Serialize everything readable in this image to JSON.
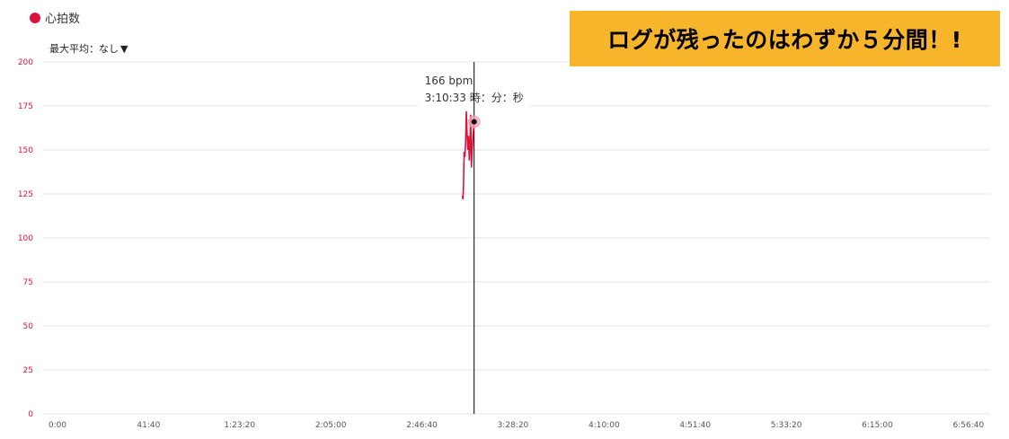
{
  "legend": {
    "label": "心拍数",
    "color": "#dc143c"
  },
  "avg_select": {
    "label": "最大平均：なし",
    "arrow": "▼"
  },
  "banner": {
    "text": "ログが残ったのはわずか５分間！!",
    "bg": "#f7b52b"
  },
  "tooltip": {
    "value": "166 bpm",
    "time": "3:10:33 時：分：秒"
  },
  "colors": {
    "series": "#dc143c",
    "ytick": "#dc143c",
    "grid": "#e6e6e6"
  },
  "chart_data": {
    "type": "line",
    "ylim": [
      0,
      200
    ],
    "yticks": [
      0,
      25,
      50,
      75,
      100,
      125,
      150,
      175,
      200
    ],
    "xlim": [
      "0:00",
      "7:00:00"
    ],
    "xticks": [
      "0:00",
      "41:40",
      "1:23:20",
      "2:05:00",
      "2:46:40",
      "3:28:20",
      "4:10:00",
      "4:51:40",
      "5:33:20",
      "6:15:00",
      "6:56:40"
    ],
    "hover_x": "3:10:33",
    "series": [
      {
        "x": [
          "3:05:10",
          "3:05:25",
          "3:05:40",
          "3:06:00",
          "3:06:20",
          "3:06:40",
          "3:07:00",
          "3:07:20",
          "3:07:40",
          "3:08:00",
          "3:08:20",
          "3:08:40",
          "3:09:00",
          "3:09:20",
          "3:09:40",
          "3:10:00",
          "3:10:20",
          "3:10:33"
        ],
        "values": [
          124,
          122,
          128,
          149,
          146,
          154,
          172,
          160,
          150,
          158,
          144,
          152,
          170,
          140,
          150,
          156,
          162,
          166
        ]
      }
    ]
  }
}
